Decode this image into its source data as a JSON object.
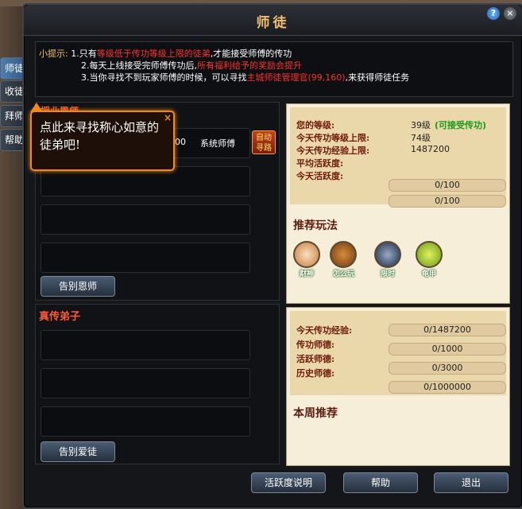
{
  "window": {
    "title": "师徒",
    "help_icon": "?",
    "close_icon": "×"
  },
  "tips": {
    "label": "小提示:",
    "lines": [
      {
        "prefix": "1.只有",
        "highlight": "等级低于传功等级上限的徒弟",
        "suffix": ",才能接受师傅的传功"
      },
      {
        "prefix": "2.每天上线接受完师傅传功后,",
        "highlight": "所有福利给予的奖励会提升",
        "suffix": ""
      },
      {
        "prefix": "3.当你寻找不到玩家师傅的时候，可以寻找",
        "highlight": "主城师徒管理官(99,160)",
        "suffix": ",来获得师徒任务"
      }
    ]
  },
  "side_tabs": [
    "师徒",
    "收徒",
    "拜师",
    "帮助"
  ],
  "left_top": {
    "header": "授业恩师",
    "value": "00",
    "system_label": "系统师傅",
    "auto_path": "自动寻路",
    "button": "告别恩师"
  },
  "left_bottom": {
    "header": "真传弟子",
    "button": "告别爱徒"
  },
  "stats_top": {
    "level_label": "您的等级:",
    "level_value": "39级",
    "level_note": "(可接受传功)",
    "cap_level_label": "今天传功等级上限:",
    "cap_level_value": "74级",
    "cap_exp_label": "今天传功经验上限:",
    "cap_exp_value": "1487200",
    "avg_active_label": "平均活跃度:",
    "today_active_label": "今天活跃度:",
    "bars": [
      "0/100",
      "0/100"
    ]
  },
  "recommend": {
    "title": "推荐玩法",
    "icons": [
      {
        "name": "财神",
        "color": "#3a8a4a"
      },
      {
        "name": "怎么玩",
        "color": "#b0642a"
      },
      {
        "name": "限时",
        "color": "#2a4a7a"
      },
      {
        "name": "龟甲",
        "color": "#8ab42a"
      }
    ]
  },
  "stats_bottom": {
    "rows": [
      {
        "label": "今天传功经验:",
        "value": "0/1487200"
      },
      {
        "label": "传功师德:",
        "value": "0/1000"
      },
      {
        "label": "活跃师德:",
        "value": "0/3000"
      },
      {
        "label": "历史师德:",
        "value": "0/1000000"
      }
    ],
    "weekly_title": "本周推荐"
  },
  "bottom_buttons": [
    "活跃度说明",
    "帮助",
    "退出"
  ],
  "popup": {
    "text": "点此来寻找称心如意的徒弟吧!",
    "close": "×"
  }
}
